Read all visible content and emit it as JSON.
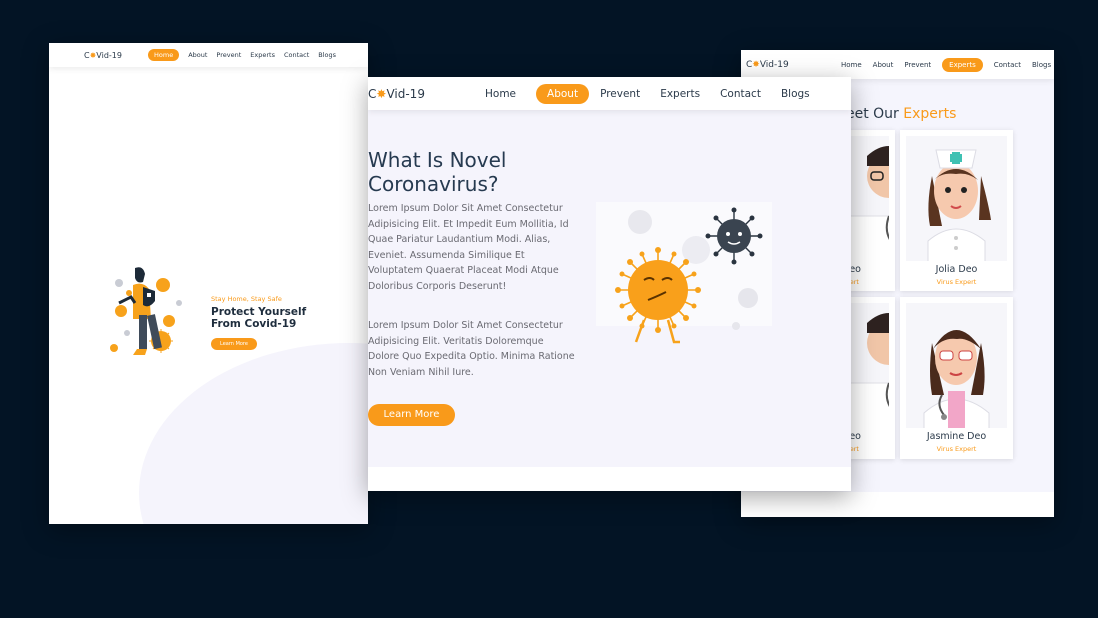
{
  "colors": {
    "background": "#031425",
    "accent": "#f99a1a",
    "text_dark": "#263a50"
  },
  "logo": {
    "prefix": "C",
    "suffix": "Vid-19"
  },
  "home_page": {
    "nav": [
      "Home",
      "About",
      "Prevent",
      "Experts",
      "Contact",
      "Blogs"
    ],
    "active_nav": "Home",
    "tagline": "Stay Home, Stay Safe",
    "title_line1": "Protect Yourself",
    "title_line2": "From Covid-19",
    "button": "Learn More"
  },
  "about_page": {
    "nav": [
      "Home",
      "About",
      "Prevent",
      "Experts",
      "Contact",
      "Blogs"
    ],
    "active_nav": "About",
    "title_line1": "What Is Novel",
    "title_line2": "Coronavirus?",
    "paragraph1": "Lorem Ipsum Dolor Sit Amet Consectetur Adipisicing Elit. Et Impedit Eum Mollitia, Id Quae Pariatur Laudantium Modi. Alias, Eveniet. Assumenda Similique Et Voluptatem Quaerat Placeat Modi Atque Doloribus Corporis Deserunt!",
    "paragraph2": "Lorem Ipsum Dolor Sit Amet Consectetur Adipisicing Elit. Veritatis Doloremque Dolore Quo Expedita Optio. Minima Ratione Non Veniam Nihil Iure.",
    "button": "Learn More"
  },
  "experts_page": {
    "nav": [
      "Home",
      "About",
      "Prevent",
      "Experts",
      "Contact",
      "Blogs"
    ],
    "active_nav": "Experts",
    "section_title": "eet Our ",
    "section_title_highlight": "Experts",
    "experts": [
      {
        "name": "eo",
        "role": "ert"
      },
      {
        "name": "Jolia Deo",
        "role": "Virus Expert"
      },
      {
        "name": "eo",
        "role": "ert"
      },
      {
        "name": "Jasmine Deo",
        "role": "Virus Expert"
      }
    ]
  }
}
